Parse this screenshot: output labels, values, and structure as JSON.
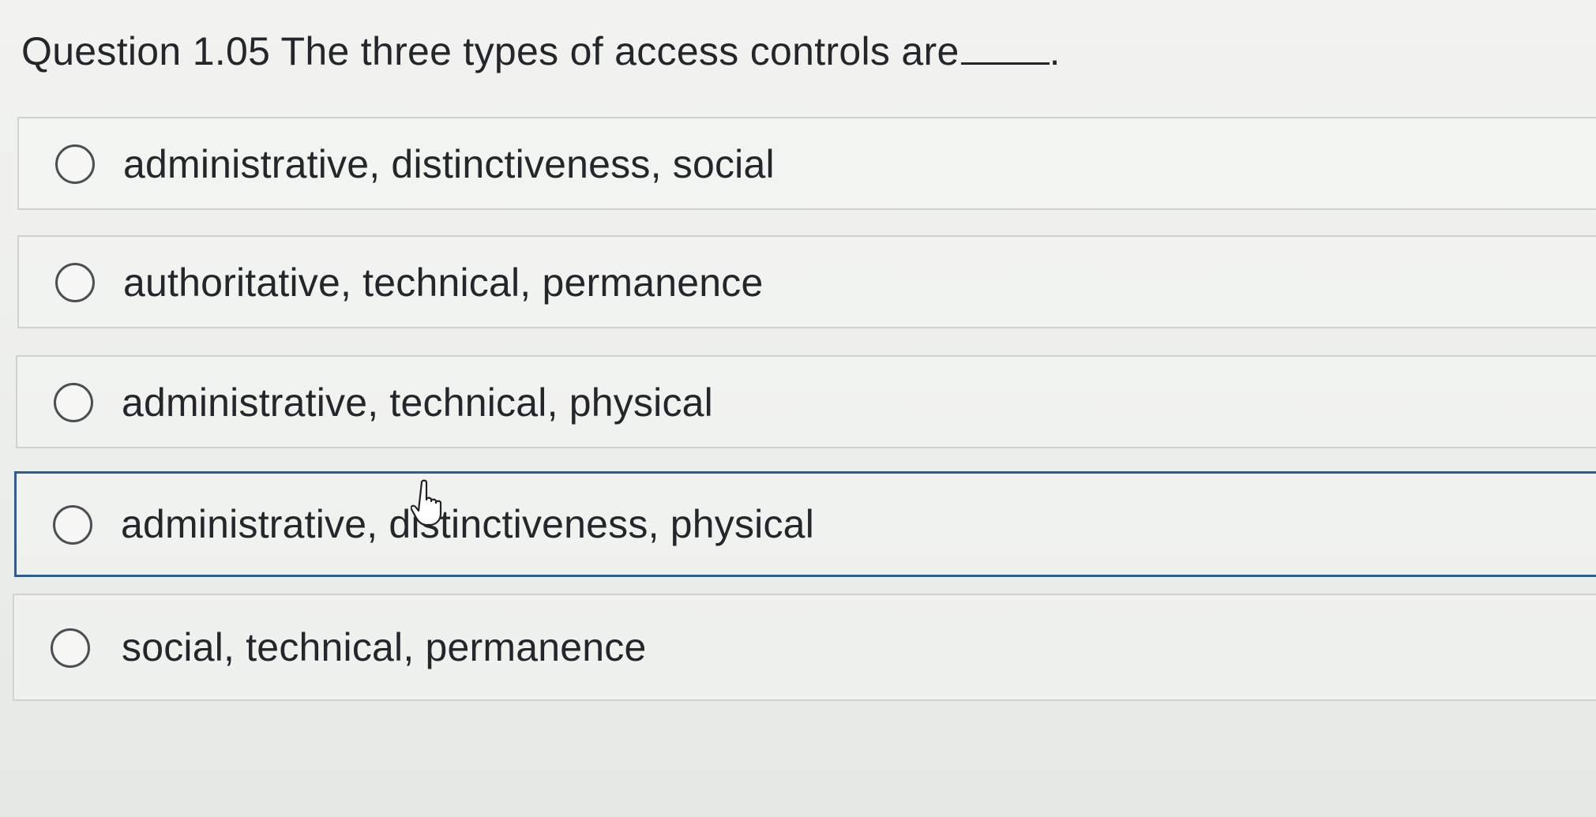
{
  "question": {
    "text": "Question 1.05 The three types of access controls are",
    "end_punct": "."
  },
  "options": [
    {
      "label": "administrative, distinctiveness, social",
      "selected": false
    },
    {
      "label": "authoritative, technical, permanence",
      "selected": false
    },
    {
      "label": "administrative, technical, physical",
      "selected": false
    },
    {
      "label": "administrative, distinctiveness, physical",
      "selected": false,
      "focused": true
    },
    {
      "label": "social, technical, permanence",
      "selected": false
    }
  ],
  "colors": {
    "focus_border": "#2f5d8f",
    "text": "#23262a"
  },
  "icons": {
    "radio": "radio-button-empty-icon",
    "cursor": "hand-pointer-cursor-icon"
  }
}
